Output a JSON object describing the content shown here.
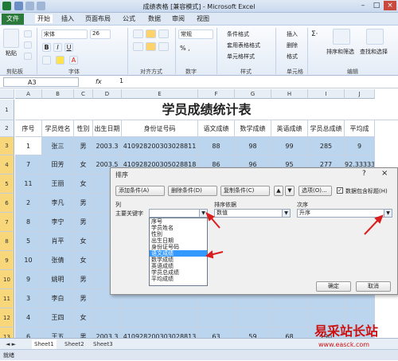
{
  "window": {
    "title": "成绩表格 [兼容模式] - Microsoft Excel"
  },
  "tabs": [
    "文件",
    "开始",
    "插入",
    "页面布局",
    "公式",
    "数据",
    "审阅",
    "视图"
  ],
  "ribbon": {
    "paste": "粘贴",
    "clipboard": "剪贴板",
    "font_name": "宋体",
    "font_size": "26",
    "font_group": "字体",
    "align_group": "对齐方式",
    "number_format": "常规",
    "number_group": "数字",
    "cond_format": "条件格式",
    "table_format": "套用表格格式",
    "cell_style": "单元格样式",
    "style_group": "样式",
    "insert": "插入",
    "delete": "删除",
    "format": "格式",
    "cells_group": "单元格",
    "sort_filter": "排序和筛选",
    "find_select": "查找和选择",
    "edit_group": "编辑"
  },
  "formula_bar": {
    "name_box": "A3",
    "fx": "fx",
    "value": "1"
  },
  "sheet": {
    "title": "学员成绩统计表",
    "columns": [
      "A",
      "B",
      "C",
      "D",
      "E",
      "F",
      "G",
      "H",
      "I",
      "J"
    ],
    "headers": [
      "序号",
      "学员姓名",
      "性别",
      "出生日期",
      "身份证号码",
      "语文成绩",
      "数学成绩",
      "英语成绩",
      "学员总成绩",
      "平均成"
    ],
    "rows": [
      {
        "num": "1",
        "cells": [
          "1",
          "张三",
          "男",
          "2003.3",
          "410928200303028811",
          "88",
          "98",
          "99",
          "285",
          "9"
        ]
      },
      {
        "num": "2",
        "cells": [
          "7",
          "田芳",
          "女",
          "2003.5",
          "410928200305028818",
          "86",
          "96",
          "95",
          "277",
          "92.33333"
        ]
      },
      {
        "num": "3",
        "cells": [
          "11",
          "王丽",
          "女",
          "",
          "",
          "",
          "",
          "",
          "",
          ""
        ]
      },
      {
        "num": "4",
        "cells": [
          "2",
          "李凡",
          "男",
          "",
          "",
          "",
          "",
          "",
          "",
          ""
        ]
      },
      {
        "num": "5",
        "cells": [
          "8",
          "李宁",
          "男",
          "",
          "",
          "",
          "",
          "",
          "",
          ""
        ]
      },
      {
        "num": "6",
        "cells": [
          "5",
          "肖平",
          "女",
          "",
          "",
          "",
          "",
          "",
          "",
          ""
        ]
      },
      {
        "num": "7",
        "cells": [
          "10",
          "张倩",
          "女",
          "",
          "",
          "",
          "",
          "",
          "",
          ""
        ]
      },
      {
        "num": "8",
        "cells": [
          "9",
          "姚明",
          "男",
          "",
          "",
          "",
          "",
          "",
          "",
          ""
        ]
      },
      {
        "num": "9",
        "cells": [
          "3",
          "李白",
          "男",
          "",
          "",
          "",
          "",
          "",
          "",
          ""
        ]
      },
      {
        "num": "10",
        "cells": [
          "4",
          "王四",
          "女",
          "",
          "",
          "",
          "",
          "",
          "",
          ""
        ]
      },
      {
        "num": "11",
        "cells": [
          "6",
          "王五",
          "男",
          "2003.3",
          "410928200303028813",
          "63",
          "59",
          "68",
          "190",
          ""
        ]
      },
      {
        "num": "12",
        "cells": [
          "12",
          "张一",
          "男",
          "2004.2",
          "410928200402028812",
          "67",
          "65",
          "",
          "",
          ""
        ]
      }
    ],
    "row_numbers": [
      "1",
      "2",
      "3",
      "4",
      "5",
      "6",
      "7",
      "8",
      "9",
      "10",
      "11",
      "12",
      "13",
      "14"
    ],
    "tabs": [
      "Sheet1",
      "Sheet2",
      "Sheet3"
    ],
    "status": "就绪"
  },
  "dialog": {
    "title": "排序",
    "help": "?",
    "close": "×",
    "add": "添加条件(A)",
    "delete": "删除条件(D)",
    "copy": "复制条件(C)",
    "options": "选项(O)...",
    "has_header": "数据包含标题(H)",
    "col_label": "列",
    "sort_on_label": "排序依据",
    "order_label": "次序",
    "key_label": "主要关键字",
    "key_value": "",
    "sort_on": "数值",
    "order": "升序",
    "list": [
      "序号",
      "学员姓名",
      "性别",
      "出生日期",
      "身份证号码",
      "语文成绩",
      "数学成绩",
      "英语成绩",
      "学员总成绩",
      "平均成绩"
    ],
    "ok": "确定",
    "cancel": "取消"
  },
  "watermark": {
    "text": "易采站长站",
    "url": "www.easck.com"
  }
}
